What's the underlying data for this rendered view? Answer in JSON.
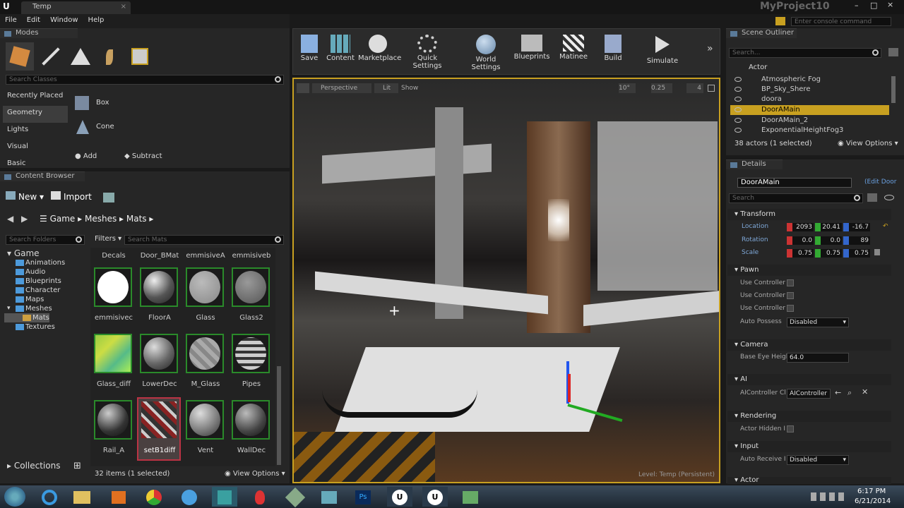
{
  "window": {
    "tab": "Temp",
    "project": "MyProject10",
    "console_placeholder": "Enter console command"
  },
  "menu": [
    "File",
    "Edit",
    "Window",
    "Help"
  ],
  "modes": {
    "title": "Modes",
    "search_placeholder": "Search Classes",
    "categories": [
      "Recently Placed",
      "Geometry",
      "Lights",
      "Visual",
      "Basic"
    ],
    "items": [
      "Box",
      "Cone"
    ],
    "add": "Add",
    "subtract": "Subtract"
  },
  "content_browser": {
    "title": "Content Browser",
    "new": "New",
    "import": "Import",
    "path": [
      "Game",
      "Meshes",
      "Mats"
    ],
    "search_folders": "Search Folders",
    "filters": "Filters",
    "search_mats": "Search Mats",
    "tree": [
      "Game",
      "Animations",
      "Audio",
      "Blueprints",
      "Character",
      "Maps",
      "Meshes",
      "Mats",
      "Textures"
    ],
    "top_labels": [
      "Decals",
      "Door_BMat",
      "emmisiveA",
      "emmisiveb"
    ],
    "assets": [
      "emmisivec",
      "FloorA",
      "Glass",
      "Glass2",
      "Glass_diff",
      "LowerDec",
      "M_Glass",
      "Pipes",
      "Rail_A",
      "setB1diff",
      "Vent",
      "WallDec"
    ],
    "count": "32 items (1 selected)",
    "view_options": "View Options",
    "collections": "Collections"
  },
  "toolbar": [
    "Save",
    "Content",
    "Marketplace",
    "Quick Settings",
    "World Settings",
    "Blueprints",
    "Matinee",
    "Build",
    "Simulate"
  ],
  "viewport": {
    "perspective": "Perspective",
    "lit": "Lit",
    "show": "Show",
    "grid": "10°",
    "scale": "0.25",
    "cam": "4",
    "level": "Level:  Temp (Persistent)"
  },
  "outliner": {
    "title": "Scene Outliner",
    "search_placeholder": "Search...",
    "column": "Actor",
    "actors": [
      "Atmospheric Fog",
      "BP_Sky_Shere",
      "doora",
      "DoorAMain",
      "DoorAMain_2",
      "ExponentialHeightFog3"
    ],
    "count": "38 actors (1 selected)",
    "view_options": "View Options"
  },
  "details": {
    "title": "Details",
    "name": "DoorAMain",
    "edit": "Edit Door",
    "search_placeholder": "Search",
    "transform": "Transform",
    "location": "Location",
    "rotation": "Rotation",
    "scale": "Scale",
    "loc": [
      "2093",
      "20.41",
      "-16.7"
    ],
    "rot": [
      "0.0",
      "0.0",
      "89"
    ],
    "scl": [
      "0.75",
      "0.75",
      "0.75"
    ],
    "pawn": "Pawn",
    "use_controller": "Use Controller",
    "auto_possess": "Auto Possess",
    "disabled": "Disabled",
    "camera": "Camera",
    "base_eye": "Base Eye Heigh",
    "eye_val": "64.0",
    "ai": "AI",
    "ai_controller": "AIController Cl",
    "ai_val": "AIController",
    "rendering": "Rendering",
    "hidden": "Actor Hidden I",
    "input": "Input",
    "auto_receive": "Auto Receive I",
    "actor": "Actor"
  },
  "clock": {
    "time": "6:17 PM",
    "date": "6/21/2014"
  }
}
